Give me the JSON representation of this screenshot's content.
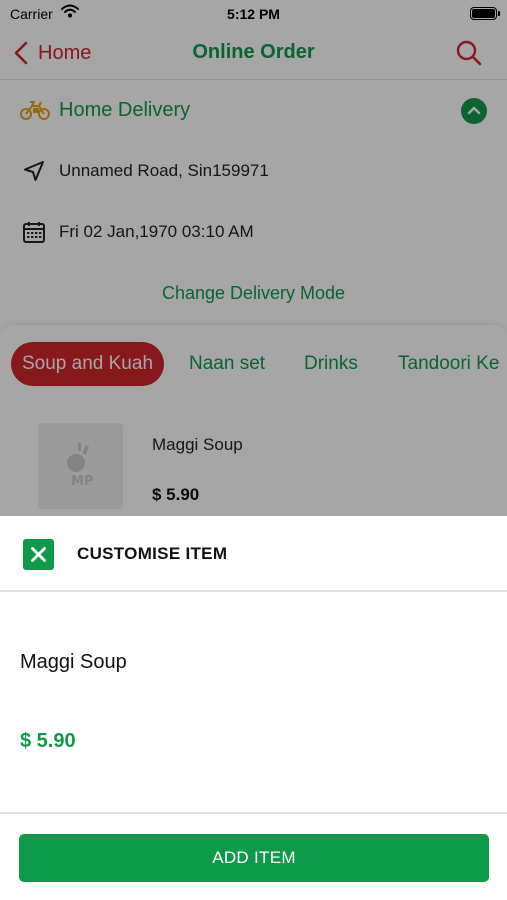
{
  "status_bar": {
    "carrier": "Carrier",
    "time": "5:12 PM"
  },
  "navbar": {
    "back_label": "Home",
    "title": "Online Order"
  },
  "delivery": {
    "mode_label": "Home Delivery",
    "address": "Unnamed Road, Sin159971",
    "datetime": "Fri 02 Jan,1970 03:10 AM",
    "change_mode_label": "Change Delivery Mode"
  },
  "menu": {
    "categories": [
      "Soup and Kuah",
      "Naan set",
      "Drinks",
      "Tandoori Ke"
    ],
    "active_category": "Soup and Kuah",
    "item": {
      "name": "Maggi Soup",
      "price": "$ 5.90"
    }
  },
  "sheet": {
    "title": "CUSTOMISE ITEM",
    "item_name": "Maggi Soup",
    "item_price": "$ 5.90",
    "add_button_label": "ADD ITEM"
  },
  "colors": {
    "brand_green": "#0e9a4a",
    "brand_red": "#d0262b",
    "overlay": "rgba(0,0,0,0.35)"
  },
  "icons": [
    "wifi-icon",
    "battery-icon",
    "chevron-left-icon",
    "search-icon",
    "bike-icon",
    "chevron-up-icon",
    "location-arrow-icon",
    "calendar-icon",
    "close-icon"
  ]
}
